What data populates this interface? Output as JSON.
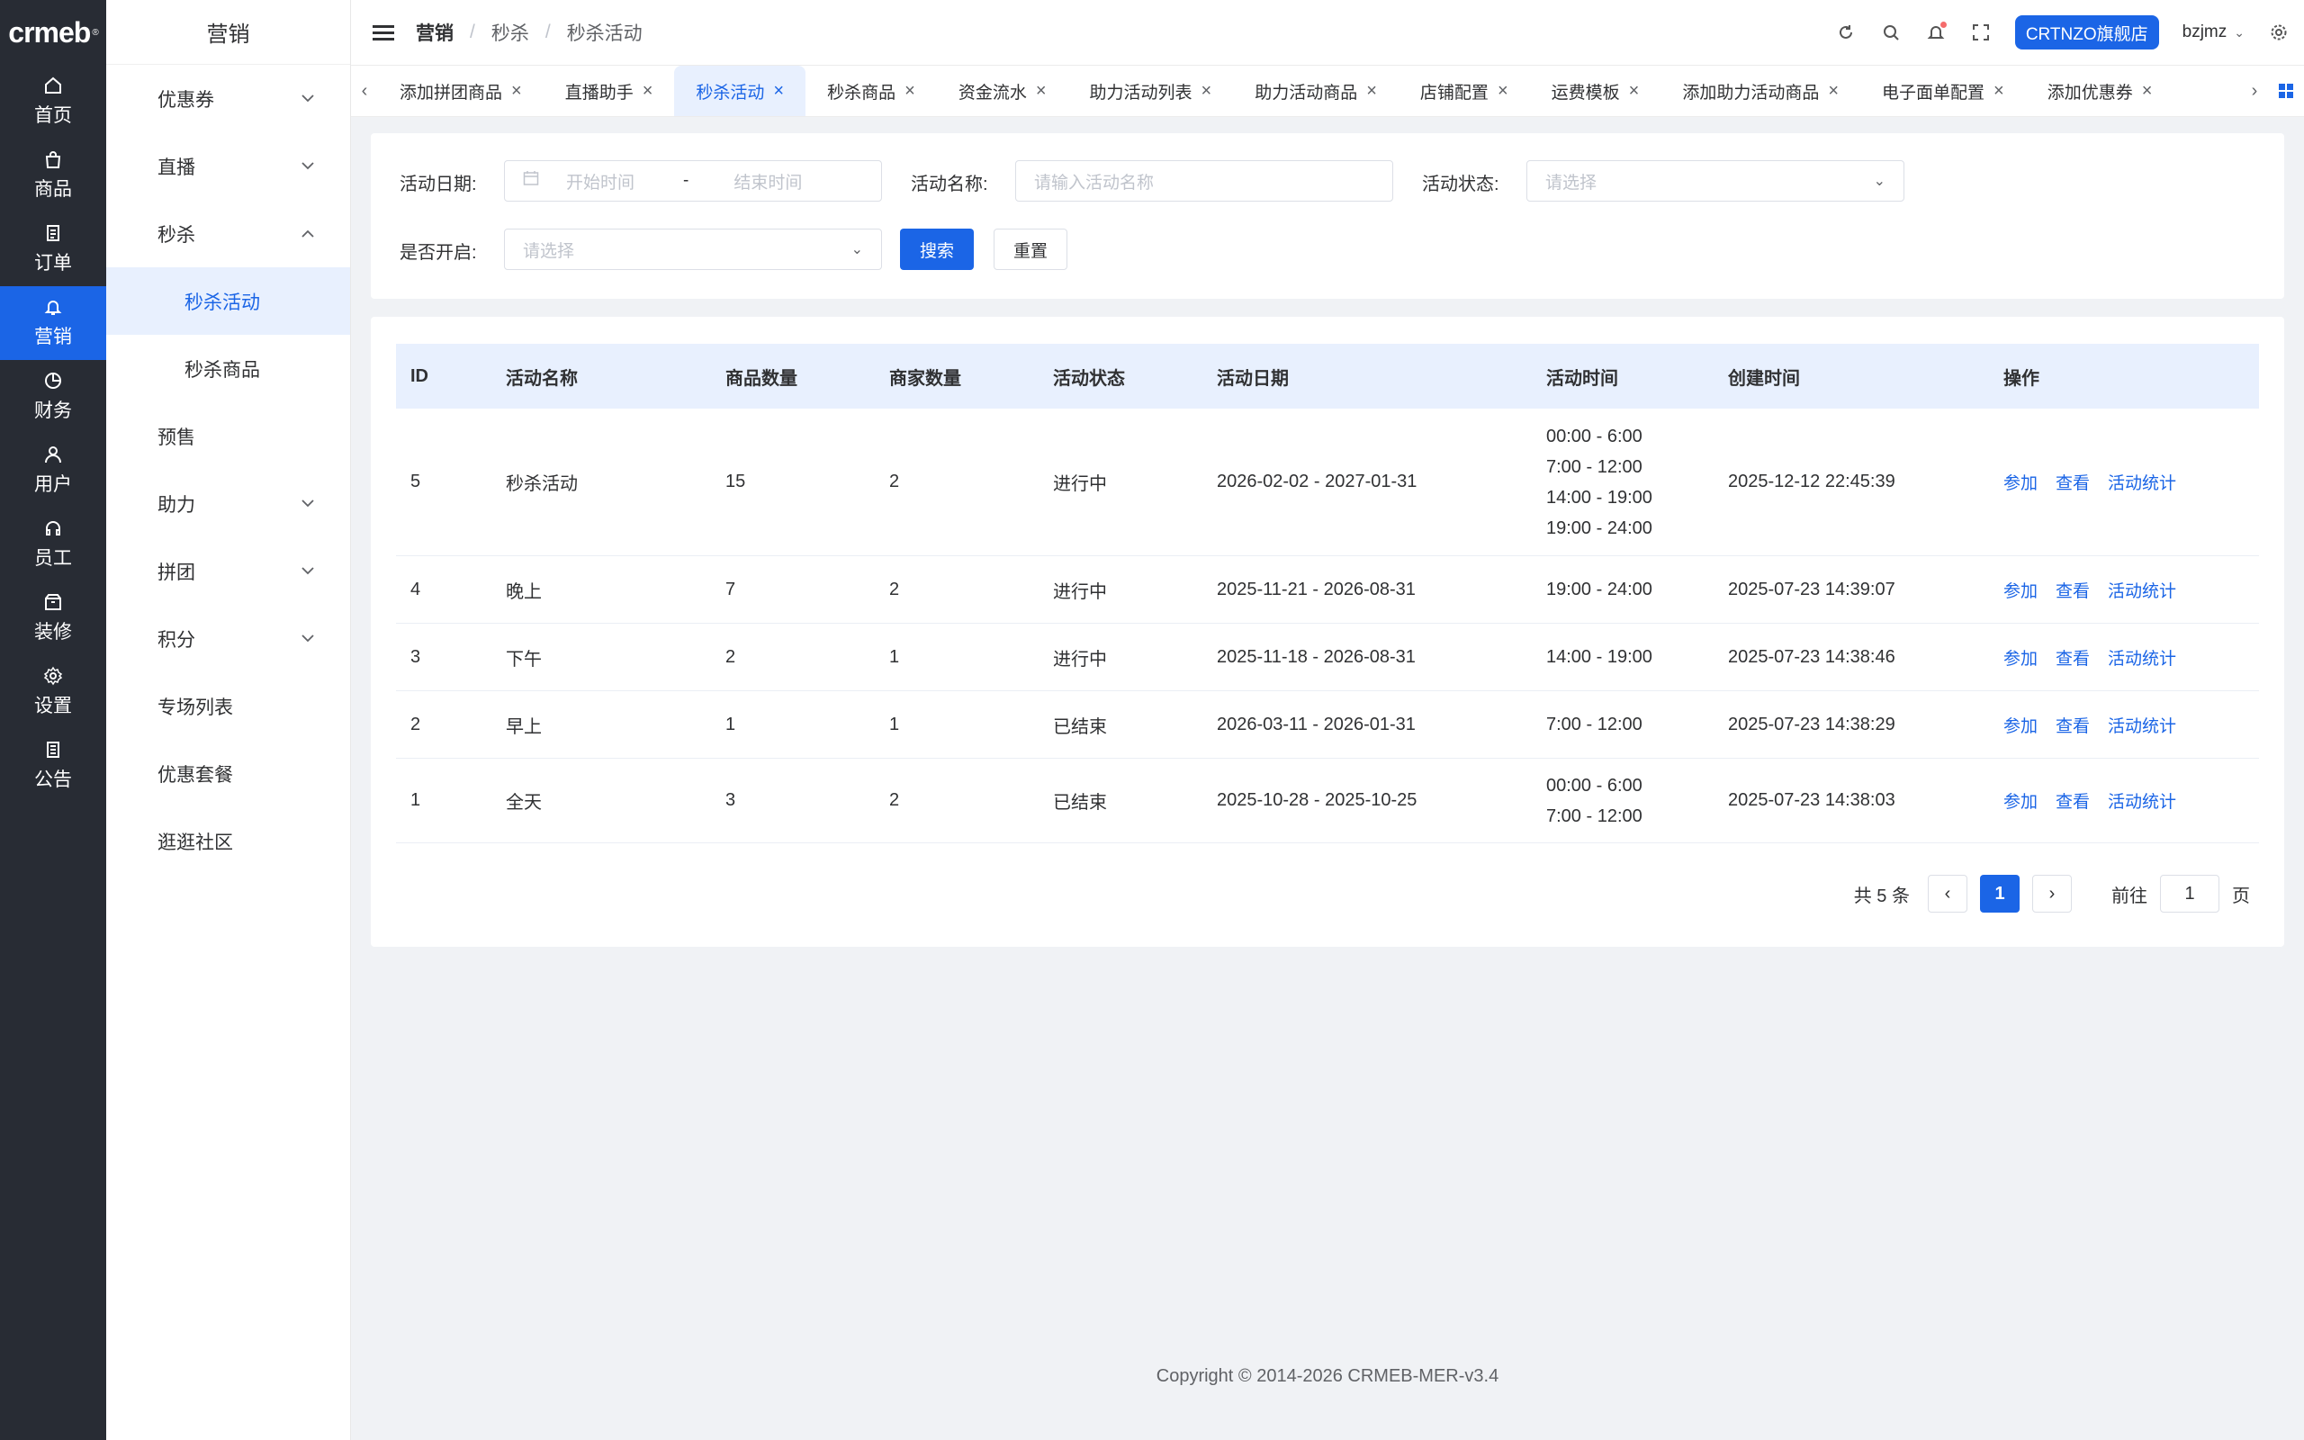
{
  "rail": {
    "logo": "crmeb",
    "items": [
      {
        "label": "首页",
        "icon": "home-icon"
      },
      {
        "label": "商品",
        "icon": "bag-icon"
      },
      {
        "label": "订单",
        "icon": "order-icon"
      },
      {
        "label": "营销",
        "icon": "bell-icon",
        "active": true
      },
      {
        "label": "财务",
        "icon": "pie-icon"
      },
      {
        "label": "用户",
        "icon": "user-icon"
      },
      {
        "label": "员工",
        "icon": "headset-icon"
      },
      {
        "label": "装修",
        "icon": "box-icon"
      },
      {
        "label": "设置",
        "icon": "gear-icon"
      },
      {
        "label": "公告",
        "icon": "notice-icon"
      }
    ]
  },
  "subnav": {
    "title": "营销",
    "items": [
      {
        "label": "优惠券",
        "expand": "down"
      },
      {
        "label": "直播",
        "expand": "down"
      },
      {
        "label": "秒杀",
        "expand": "up"
      },
      {
        "label": "秒杀活动",
        "child": true,
        "active": true
      },
      {
        "label": "秒杀商品",
        "child": true
      },
      {
        "label": "预售"
      },
      {
        "label": "助力",
        "expand": "down"
      },
      {
        "label": "拼团",
        "expand": "down"
      },
      {
        "label": "积分",
        "expand": "down"
      },
      {
        "label": "专场列表"
      },
      {
        "label": "优惠套餐"
      },
      {
        "label": "逛逛社区"
      }
    ]
  },
  "header": {
    "breadcrumb": [
      "营销",
      "秒杀",
      "秒杀活动"
    ],
    "separator": "/",
    "store": "CRTNZO旗舰店",
    "user": "bzjmz"
  },
  "tabs": [
    {
      "label": "添加拼团商品"
    },
    {
      "label": "直播助手"
    },
    {
      "label": "秒杀活动",
      "active": true
    },
    {
      "label": "秒杀商品"
    },
    {
      "label": "资金流水"
    },
    {
      "label": "助力活动列表"
    },
    {
      "label": "助力活动商品"
    },
    {
      "label": "店铺配置"
    },
    {
      "label": "运费模板"
    },
    {
      "label": "添加助力活动商品"
    },
    {
      "label": "电子面单配置"
    },
    {
      "label": "添加优惠券"
    }
  ],
  "filters": {
    "date_label": "活动日期:",
    "date_start_placeholder": "开始时间",
    "date_sep": "-",
    "date_end_placeholder": "结束时间",
    "name_label": "活动名称:",
    "name_placeholder": "请输入活动名称",
    "status_label": "活动状态:",
    "status_placeholder": "请选择",
    "open_label": "是否开启:",
    "open_placeholder": "请选择",
    "search_button": "搜索",
    "reset_button": "重置"
  },
  "table": {
    "columns": [
      "ID",
      "活动名称",
      "商品数量",
      "商家数量",
      "活动状态",
      "活动日期",
      "活动时间",
      "创建时间",
      "操作"
    ],
    "rows": [
      {
        "id": "5",
        "name": "秒杀活动",
        "goods": "15",
        "merchants": "2",
        "status": "进行中",
        "date": "2026-02-02 - 2027-01-31",
        "times": [
          "00:00 - 6:00",
          "7:00 - 12:00",
          "14:00 - 19:00",
          "19:00 - 24:00"
        ],
        "created": "2025-12-12 22:45:39"
      },
      {
        "id": "4",
        "name": "晚上",
        "goods": "7",
        "merchants": "2",
        "status": "进行中",
        "date": "2025-11-21 - 2026-08-31",
        "times": [
          "19:00 - 24:00"
        ],
        "created": "2025-07-23 14:39:07"
      },
      {
        "id": "3",
        "name": "下午",
        "goods": "2",
        "merchants": "1",
        "status": "进行中",
        "date": "2025-11-18 - 2026-08-31",
        "times": [
          "14:00 - 19:00"
        ],
        "created": "2025-07-23 14:38:46"
      },
      {
        "id": "2",
        "name": "早上",
        "goods": "1",
        "merchants": "1",
        "status": "已结束",
        "date": "2026-03-11 - 2026-01-31",
        "times": [
          "7:00 - 12:00"
        ],
        "created": "2025-07-23 14:38:29"
      },
      {
        "id": "1",
        "name": "全天",
        "goods": "3",
        "merchants": "2",
        "status": "已结束",
        "date": "2025-10-28 - 2025-10-25",
        "times": [
          "00:00 - 6:00",
          "7:00 - 12:00"
        ],
        "created": "2025-07-23 14:38:03"
      }
    ],
    "actions": [
      "参加",
      "查看",
      "活动统计"
    ]
  },
  "pagination": {
    "total": "共 5 条",
    "current": "1",
    "goto_label": "前往",
    "goto_value": "1",
    "page_suffix": "页"
  },
  "footer": "Copyright © 2014-2026 CRMEB-MER-v3.4",
  "colors": {
    "primary": "#1b65e6",
    "rail_bg": "#282c34",
    "header_bg": "#e8f0fe"
  }
}
